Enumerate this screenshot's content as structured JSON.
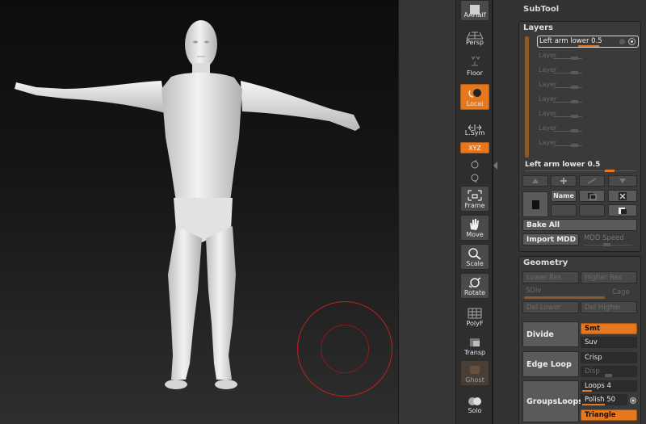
{
  "shelf": {
    "aahalf": "AAHalf",
    "persp": "Persp",
    "floor": "Floor",
    "local": "Local",
    "lsym": "L.Sym",
    "xyz": "XYZ",
    "frame": "Frame",
    "move": "Move",
    "scale": "Scale",
    "rotate": "Rotate",
    "polyf": "PolyF",
    "transp": "Transp",
    "ghost": "Ghost",
    "solo": "Solo"
  },
  "tray": {
    "subtool_title": "SubTool",
    "layers": {
      "title": "Layers",
      "active_layer": "Left arm lower 0.5",
      "empty_layers": [
        "Layer",
        "Layer",
        "Layer",
        "Layer",
        "Layer",
        "Layer",
        "Layer"
      ],
      "intensity_label": "Left arm lower 0.5",
      "name_button": "Name",
      "bake_all": "Bake All",
      "import_mdd": "Import MDD",
      "mdd_speed": "MDD Speed"
    },
    "geometry": {
      "title": "Geometry",
      "lower_res": "Lower Res",
      "higher_res": "Higher Res",
      "sdiv": "SDiv",
      "cage": "Cage",
      "del_lower": "Del Lower",
      "del_higher": "Del Higher",
      "divide": "Divide",
      "smt": "Smt",
      "suv": "Suv",
      "edge_loop": "Edge Loop",
      "crisp": "Crisp",
      "disp": "Disp",
      "groups_loops": "GroupsLoops",
      "loops": "Loops 4",
      "polish": "Polish 50",
      "triangle": "Triangle"
    }
  },
  "colors": {
    "accent": "#e5771e",
    "brush_ring": "#c0201c",
    "panel": "#3a3a3a"
  }
}
